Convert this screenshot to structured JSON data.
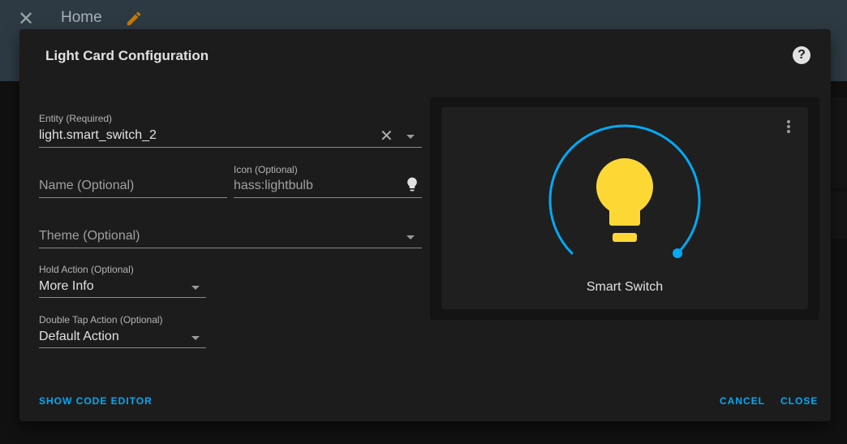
{
  "header": {
    "title": "Home"
  },
  "dialog": {
    "title": "Light Card Configuration",
    "entity": {
      "label": "Entity (Required)",
      "value": "light.smart_switch_2"
    },
    "name": {
      "placeholder": "Name (Optional)"
    },
    "icon": {
      "label": "Icon (Optional)",
      "value": "hass:lightbulb"
    },
    "theme": {
      "placeholder": "Theme (Optional)"
    },
    "hold_action": {
      "label": "Hold Action (Optional)",
      "value": "More Info"
    },
    "double_tap_action": {
      "label": "Double Tap Action (Optional)",
      "value": "Default Action"
    },
    "buttons": {
      "show_code_editor": "SHOW CODE EDITOR",
      "cancel": "CANCEL",
      "close": "CLOSE"
    }
  },
  "preview": {
    "name": "Smart Switch",
    "brightness_percent": 100,
    "arc_color": "#03a9f4",
    "bulb_color": "#fdd835"
  },
  "colors": {
    "accent": "#03a9f4",
    "edit": "#c77a00"
  }
}
